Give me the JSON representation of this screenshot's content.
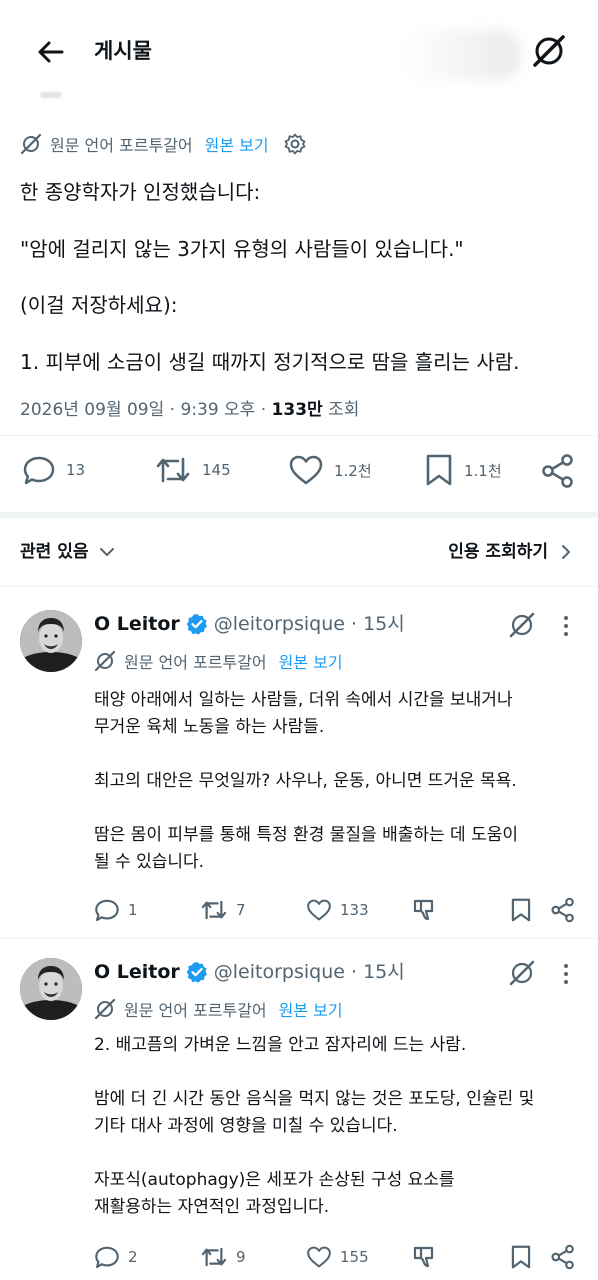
{
  "header": {
    "title": "게시물",
    "back_icon": "arrow-left-icon",
    "grok_icon": "grok-icon"
  },
  "post": {
    "translate_label": "원문 언어 포르투갈어",
    "show_original": "원본 보기",
    "lines": [
      "한 종양학자가 인정했습니다:",
      "\"암에 걸리지 않는 3가지 유형의 사람들이 있습니다.\"",
      "(이걸 저장하세요):",
      " 1. 피부에 소금이 생길 때까지 정기적으로 땀을 흘리는 사람."
    ],
    "date": "2026년 09월 09일 · 9:39 오후 · ",
    "views_count": "133만",
    "views_label": " 조회",
    "actions": {
      "reply": "13",
      "repost": "145",
      "like": "1.2천",
      "bookmark": "1.1천"
    }
  },
  "tabs": {
    "related": "관련 있음",
    "quotes": "인용 조회하기"
  },
  "replies": [
    {
      "name": "O Leitor",
      "handle": "@leitorpsique · 15시",
      "translate_label": "원문 언어 포르투갈어",
      "show_original": "원본 보기",
      "lines": [
        "태양 아래에서 일하는 사람들, 더위 속에서 시간을 보내거나",
        "무거운 육체 노동을 하는 사람들.",
        "",
        "최고의 대안은 무엇일까? 사우나, 운동, 아니면 뜨거운 목욕.",
        "",
        "땀은 몸이 피부를 통해 특정 환경 물질을 배출하는 데 도움이",
        "될 수 있습니다."
      ],
      "actions": {
        "reply": "1",
        "repost": "7",
        "like": "133"
      }
    },
    {
      "name": "O Leitor",
      "handle": "@leitorpsique · 15시",
      "translate_label": "원문 언어 포르투갈어",
      "show_original": "원본 보기",
      "lines": [
        "2. 배고픔의 가벼운 느낌을 안고 잠자리에 드는 사람.",
        "",
        "밤에 더 긴 시간 동안 음식을 먹지 않는 것은 포도당, 인슐린 및",
        "기타 대사 과정에 영향을 미칠 수 있습니다.",
        "",
        "자포식(autophagy)은 세포가 손상된 구성 요소를",
        "재활용하는 자연적인 과정입니다."
      ],
      "actions": {
        "reply": "2",
        "repost": "9",
        "like": "155"
      }
    }
  ],
  "colors": {
    "accent": "#1d9bf0",
    "muted": "#536471",
    "text": "#0f1419",
    "divider": "#eff3f4"
  }
}
